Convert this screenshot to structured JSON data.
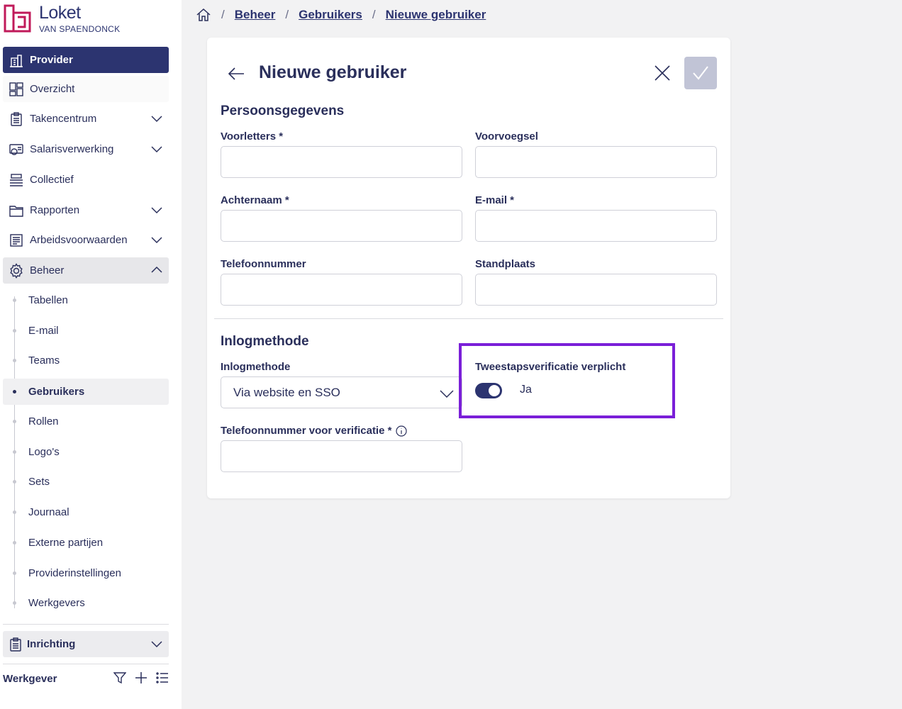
{
  "brand": {
    "title": "Loket",
    "subtitle": "VAN SPAENDONCK",
    "color": "#c01a5a"
  },
  "sidebar": {
    "provider": "Provider",
    "items": [
      {
        "label": "Overzicht",
        "icon": "dashboard-icon"
      },
      {
        "label": "Takencentrum",
        "icon": "clipboard-icon",
        "expandable": true
      },
      {
        "label": "Salarisverwerking",
        "icon": "payroll-icon",
        "expandable": true
      },
      {
        "label": "Collectief",
        "icon": "stack-icon"
      },
      {
        "label": "Rapporten",
        "icon": "folder-icon",
        "expandable": true
      },
      {
        "label": "Arbeidsvoorwaarden",
        "icon": "document-icon",
        "expandable": true
      },
      {
        "label": "Beheer",
        "icon": "gear-icon",
        "expanded": true
      }
    ],
    "beheer_items": [
      {
        "label": "Tabellen"
      },
      {
        "label": "E-mail"
      },
      {
        "label": "Teams"
      },
      {
        "label": "Gebruikers",
        "selected": true
      },
      {
        "label": "Rollen"
      },
      {
        "label": "Logo's"
      },
      {
        "label": "Sets"
      },
      {
        "label": "Journaal"
      },
      {
        "label": "Externe partijen"
      },
      {
        "label": "Providerinstellingen"
      },
      {
        "label": "Werkgevers"
      }
    ],
    "inrichting": "Inrichting",
    "werkgever": "Werkgever"
  },
  "breadcrumb": {
    "items": [
      "Beheer",
      "Gebruikers",
      "Nieuwe gebruiker"
    ],
    "separator": "/"
  },
  "form": {
    "title": "Nieuwe gebruiker",
    "section_personal": "Persoonsgegevens",
    "fields": {
      "voorletters": {
        "label": "Voorletters *",
        "value": ""
      },
      "voorvoegsel": {
        "label": "Voorvoegsel",
        "value": ""
      },
      "achternaam": {
        "label": "Achternaam *",
        "value": ""
      },
      "email": {
        "label": "E-mail *",
        "value": ""
      },
      "telefoonnummer": {
        "label": "Telefoonnummer",
        "value": ""
      },
      "standplaats": {
        "label": "Standplaats",
        "value": ""
      }
    },
    "section_login": "Inlogmethode",
    "inlogmethode": {
      "label": "Inlogmethode",
      "value": "Via website en SSO"
    },
    "tweestaps": {
      "label": "Tweestapsverificatie verplicht",
      "enabled": true,
      "value_label": "Ja"
    },
    "verificatie_telefoon": {
      "label": "Telefoonnummer voor verificatie *",
      "value": ""
    }
  },
  "colors": {
    "primary": "#2c3470",
    "highlight": "#7a1fd8",
    "save_disabled": "#c1c4d6"
  }
}
